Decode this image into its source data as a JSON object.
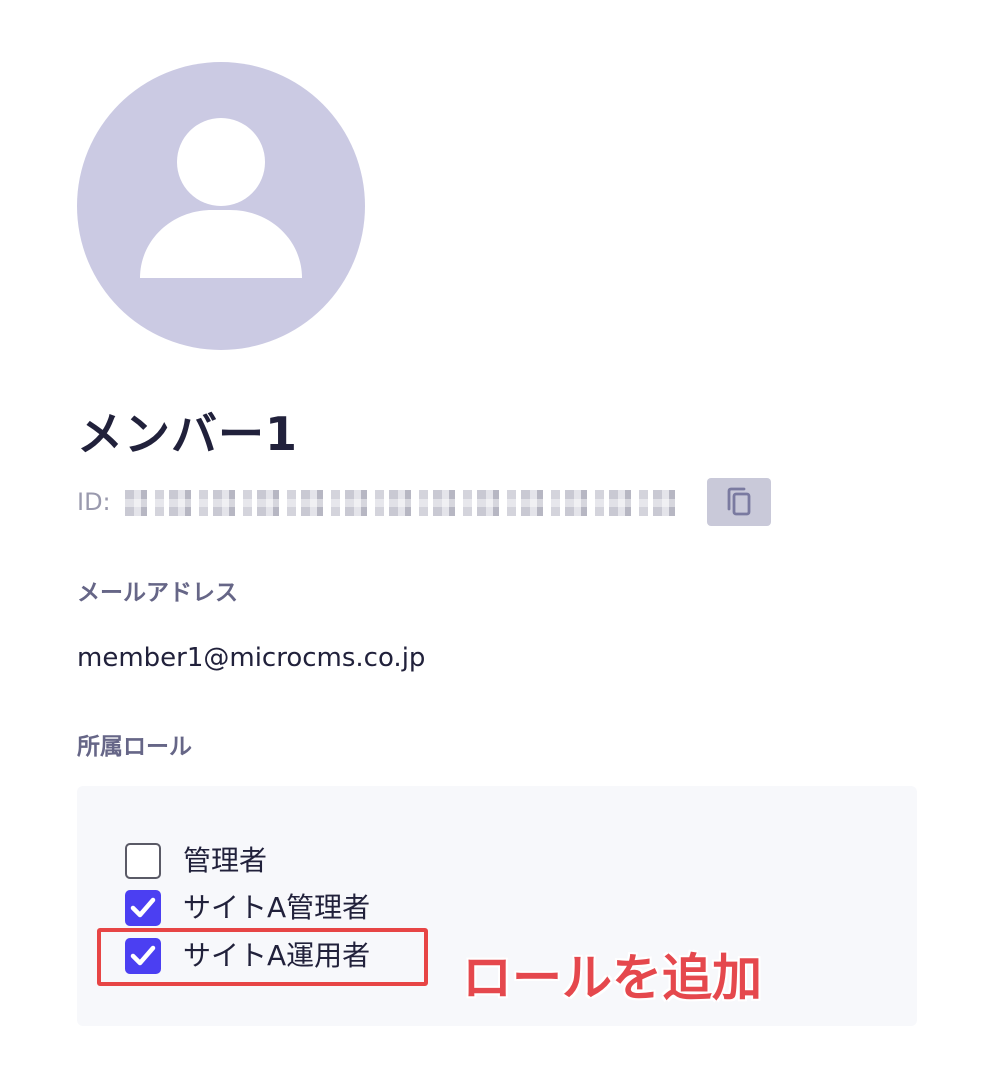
{
  "member": {
    "name": "メンバー1",
    "id_label": "ID:",
    "id_value": "a5f3c0b2-7d1e-4f8a-9c3b-2e6d1a0f7b94",
    "copy_icon": "copy-icon"
  },
  "email_section": {
    "label": "メールアドレス",
    "value": "member1@microcms.co.jp"
  },
  "roles_section": {
    "label": "所属ロール",
    "items": [
      {
        "label": "管理者",
        "checked": false
      },
      {
        "label": "サイトA管理者",
        "checked": true
      },
      {
        "label": "サイトA運用者",
        "checked": true
      }
    ]
  },
  "annotation": {
    "text": "ロールを追加",
    "color": "#e5484d"
  },
  "colors": {
    "avatar_bg": "#cbcae3",
    "checkbox_checked": "#4b3ff2",
    "highlight": "#e74545"
  }
}
